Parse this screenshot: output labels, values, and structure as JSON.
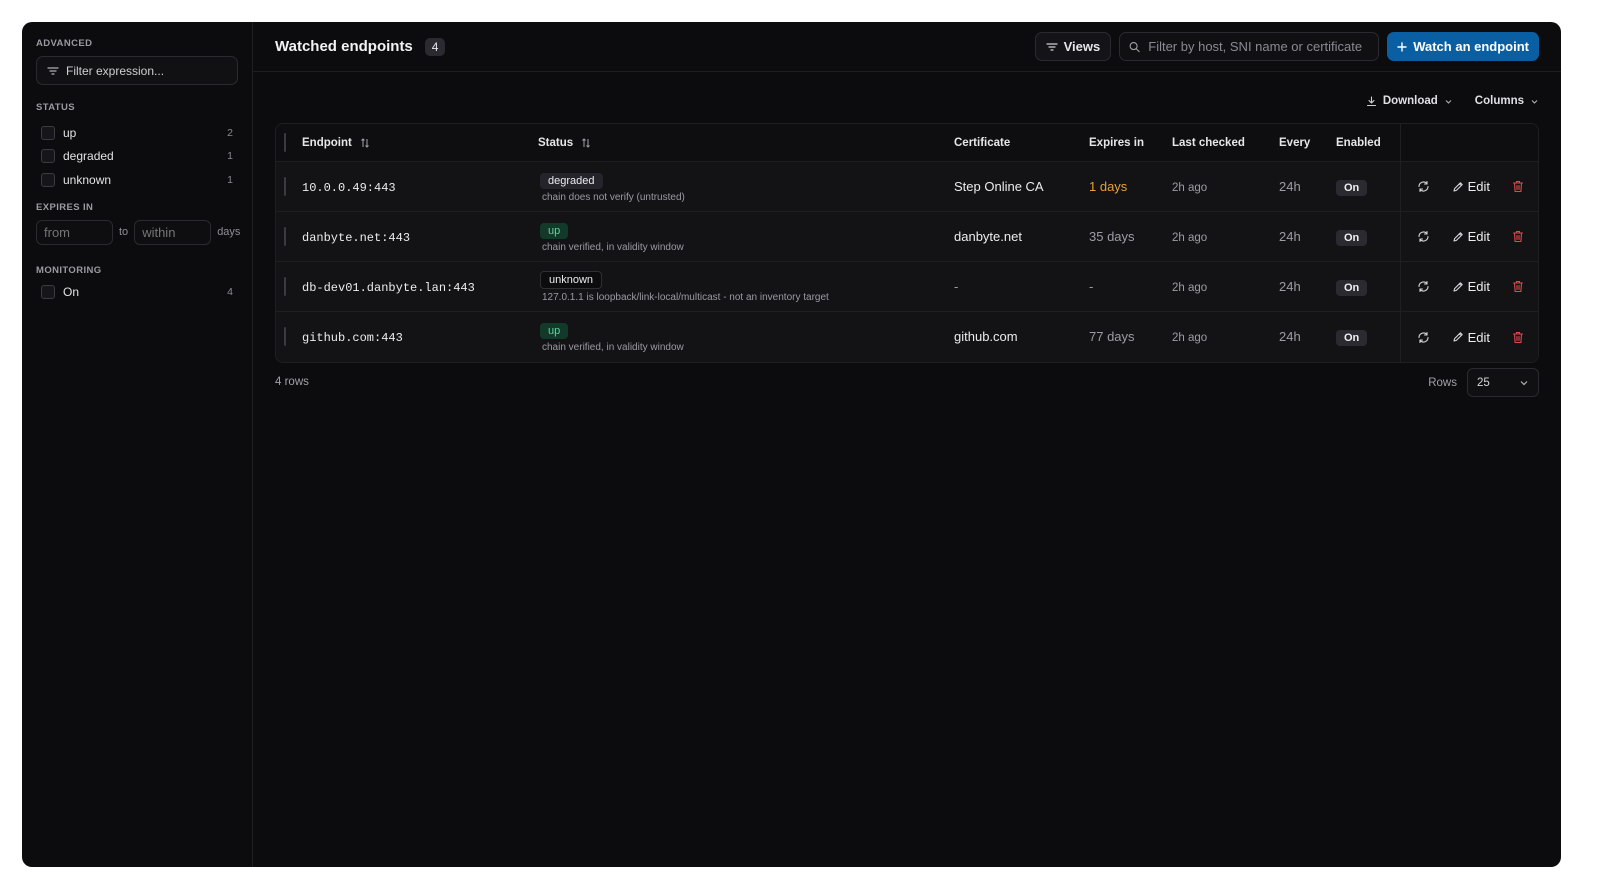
{
  "sidebar": {
    "advanced_label": "ADVANCED",
    "filter_expression_placeholder": "Filter expression...",
    "status_label": "STATUS",
    "status_items": [
      {
        "label": "up",
        "count": "2"
      },
      {
        "label": "degraded",
        "count": "1"
      },
      {
        "label": "unknown",
        "count": "1"
      }
    ],
    "expires_label": "EXPIRES IN",
    "expires_from_placeholder": "from",
    "expires_to_label": "to",
    "expires_within_placeholder": "within",
    "expires_unit": "days",
    "monitoring_label": "MONITORING",
    "monitoring_items": [
      {
        "label": "On",
        "count": "4"
      }
    ]
  },
  "header": {
    "title": "Watched endpoints",
    "count": "4",
    "views_label": "Views",
    "search_placeholder": "Filter by host, SNI name or certificate",
    "primary_label": "Watch an endpoint"
  },
  "toolbar": {
    "download_label": "Download",
    "columns_label": "Columns"
  },
  "table": {
    "columns": {
      "endpoint": "Endpoint",
      "status": "Status",
      "certificate": "Certificate",
      "expires_in": "Expires in",
      "last_checked": "Last checked",
      "every": "Every",
      "enabled": "Enabled"
    },
    "rows": [
      {
        "endpoint": "10.0.0.49:443",
        "status": "degraded",
        "status_detail": "chain does not verify (untrusted)",
        "certificate": "Step Online CA",
        "expires_in": "1 days",
        "last_checked": "2h ago",
        "every": "24h",
        "enabled": "On",
        "edit_label": "Edit"
      },
      {
        "endpoint": "danbyte.net:443",
        "status": "up",
        "status_detail": "chain verified, in validity window",
        "certificate": "danbyte.net",
        "expires_in": "35 days",
        "last_checked": "2h ago",
        "every": "24h",
        "enabled": "On",
        "edit_label": "Edit"
      },
      {
        "endpoint": "db-dev01.danbyte.lan:443",
        "status": "unknown",
        "status_detail": "127.0.1.1 is loopback/link-local/multicast - not an inventory target",
        "certificate": "-",
        "expires_in": "-",
        "last_checked": "2h ago",
        "every": "24h",
        "enabled": "On",
        "edit_label": "Edit"
      },
      {
        "endpoint": "github.com:443",
        "status": "up",
        "status_detail": "chain verified, in validity window",
        "certificate": "github.com",
        "expires_in": "77 days",
        "last_checked": "2h ago",
        "every": "24h",
        "enabled": "On",
        "edit_label": "Edit"
      }
    ]
  },
  "footer": {
    "row_count": "4 rows",
    "rows_label": "Rows",
    "rows_value": "25"
  },
  "colors": {
    "background": "#0c0c0e",
    "accent": "#0a5fa3",
    "status_up": "#5fd39a",
    "warn": "#e3a13a",
    "danger": "#e0484b"
  }
}
